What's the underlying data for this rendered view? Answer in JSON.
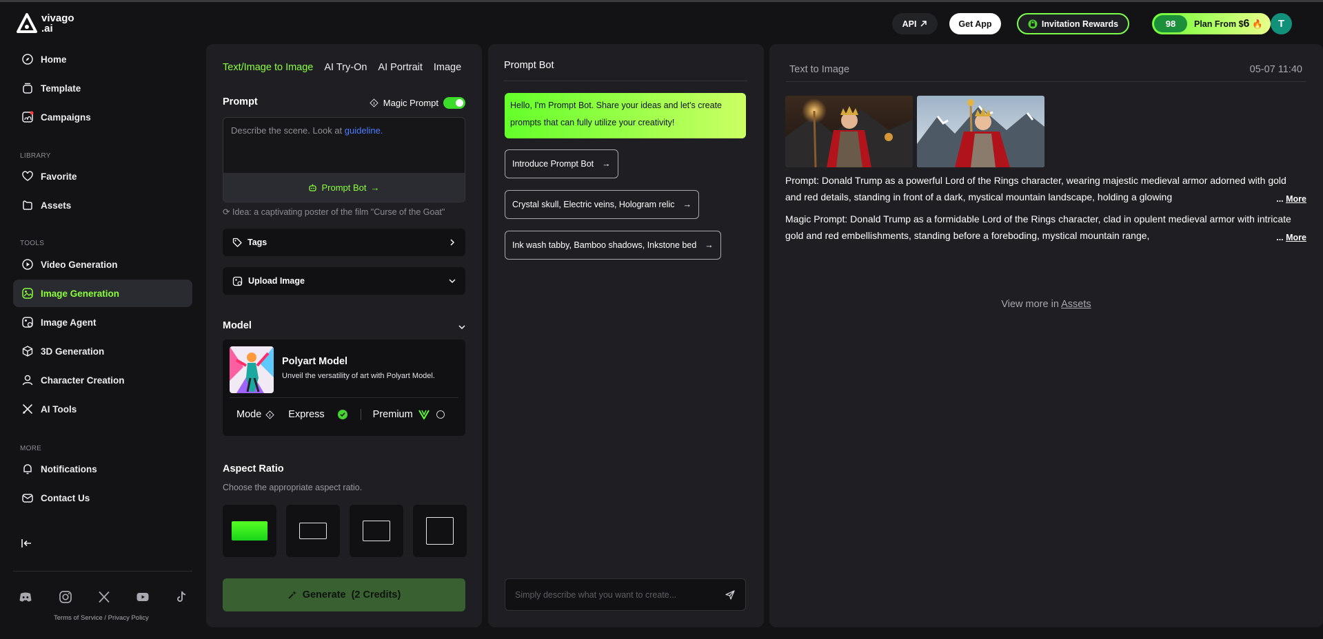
{
  "brand": {
    "logo_text_1": "vivago",
    "logo_text_2": ".ai"
  },
  "sidebar": {
    "main": [
      {
        "label": "Home"
      },
      {
        "label": "Template"
      },
      {
        "label": "Campaigns"
      }
    ],
    "library_label": "LIBRARY",
    "library": [
      {
        "label": "Favorite"
      },
      {
        "label": "Assets"
      }
    ],
    "tools_label": "TOOLS",
    "tools": [
      {
        "label": "Video Generation"
      },
      {
        "label": "Image Generation"
      },
      {
        "label": "Image Agent"
      },
      {
        "label": "3D Generation"
      },
      {
        "label": "Character Creation"
      },
      {
        "label": "AI Tools"
      }
    ],
    "more_label": "MORE",
    "more": [
      {
        "label": "Notifications"
      },
      {
        "label": "Contact Us"
      }
    ],
    "terms": "Terms of Service",
    "slash": "/",
    "privacy": "Privacy Policy"
  },
  "topbar": {
    "api": "API",
    "get_app": "Get App",
    "invitation": "Invitation Rewards",
    "credits": "98",
    "plan_prefix": "Plan From $",
    "plan_price": "6",
    "plan_emoji": "🔥",
    "avatar_letter": "T"
  },
  "generator": {
    "tabs": [
      "Text/Image to Image",
      "AI Try-On",
      "AI Portrait",
      "Image"
    ],
    "prompt_title": "Prompt",
    "magic_prompt": "Magic Prompt",
    "placeholder": "Describe the scene. Look at ",
    "placeholder_link": "guideline.",
    "prompt_bot": "Prompt Bot",
    "idea": "Idea: a captivating poster of the film \"Curse of the Goat\"",
    "tags": "Tags",
    "upload": "Upload Image",
    "model_title": "Model",
    "model_name": "Polyart Model",
    "model_desc": "Unveil the versatility of art with Polyart Model.",
    "mode_label": "Mode",
    "express": "Express",
    "premium": "Premium",
    "aspect_title": "Aspect Ratio",
    "aspect_sub": "Choose the appropriate aspect ratio.",
    "generate": "Generate",
    "generate_credits": "(2 Credits)"
  },
  "prompt_bot": {
    "title": "Prompt Bot",
    "hello": "Hello, I'm Prompt Bot. Share your ideas and let's create prompts that can fully utilize your creativity!",
    "chips": [
      {
        "label": "Introduce Prompt Bot"
      },
      {
        "label": "Crystal skull, Electric veins, Hologram relic"
      },
      {
        "label": "Ink wash tabby, Bamboo shadows, Inkstone bed"
      }
    ],
    "input_placeholder": "Simply describe what you want to create..."
  },
  "result": {
    "title": "Text to Image",
    "time": "05-07 11:40",
    "prompt": "Prompt: Donald Trump as a powerful Lord of the Rings character, wearing majestic medieval armor adorned with gold and red details, standing in front of a dark, mystical mountain landscape, holding a glowing",
    "magic_prompt": "Magic Prompt: Donald Trump as a formidable Lord of the Rings character, clad in opulent medieval armor with intricate gold and red embellishments, standing before a foreboding, mystical mountain range,",
    "ellipsis": "...",
    "more": "More",
    "view_more_prefix": "View more in ",
    "view_more_link": "Assets"
  },
  "colors": {
    "accent": "#8bff3a",
    "panel": "#1f1f23",
    "background": "#131316"
  }
}
